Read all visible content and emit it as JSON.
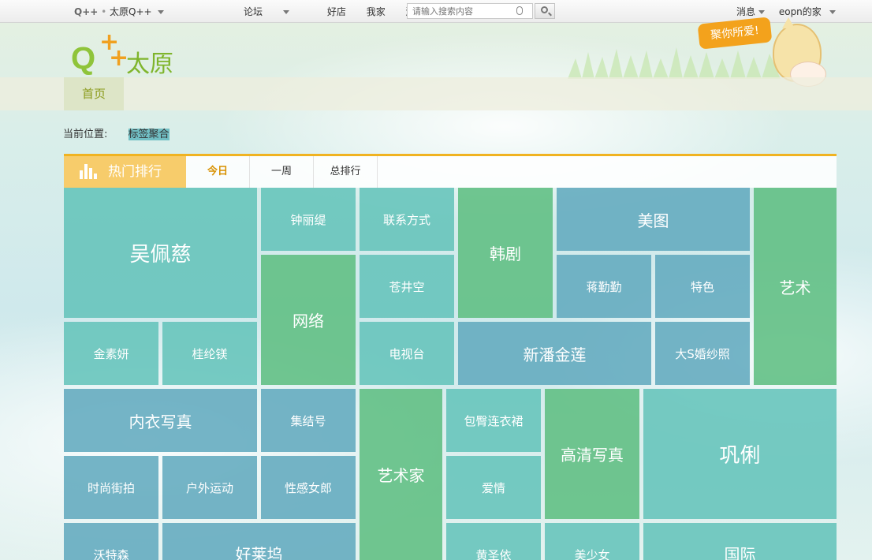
{
  "topbar": {
    "brand_left": "Q++",
    "brand_city": "太原Q++",
    "nav": [
      "论坛",
      "好店",
      "我家",
      "游戏"
    ],
    "search_placeholder": "请输入搜索内容",
    "messages": "消息",
    "user": "eopn的家"
  },
  "header": {
    "logo_letters": "Q",
    "logo_city": "太原",
    "mascot_text": "聚你所爱!"
  },
  "nav": {
    "home": "首页"
  },
  "breadcrumb": {
    "label": "当前位置:",
    "current": "标签聚合"
  },
  "tabs": {
    "hot_label": "热门排行",
    "items": [
      "今日",
      "一周",
      "总排行"
    ],
    "active_index": 0
  },
  "tiles": [
    "吴佩慈",
    "钟丽缇",
    "联系方式",
    "韩剧",
    "美图",
    "艺术",
    "网络",
    "苍井空",
    "蒋勤勤",
    "特色",
    "金素妍",
    "桂纶镁",
    "电视台",
    "新潘金莲",
    "大S婚纱照",
    "内衣写真",
    "集结号",
    "艺术家",
    "包臀连衣裙",
    "高清写真",
    "巩俐",
    "时尚街拍",
    "户外运动",
    "性感女郎",
    "爱情",
    "沃特森",
    "好莱坞",
    "黄圣依",
    "美少女",
    "国际"
  ],
  "colors": {
    "accent_orange": "#f0b321",
    "hot_tab": "#f7cc6b",
    "home_text": "#8a9a1a"
  }
}
